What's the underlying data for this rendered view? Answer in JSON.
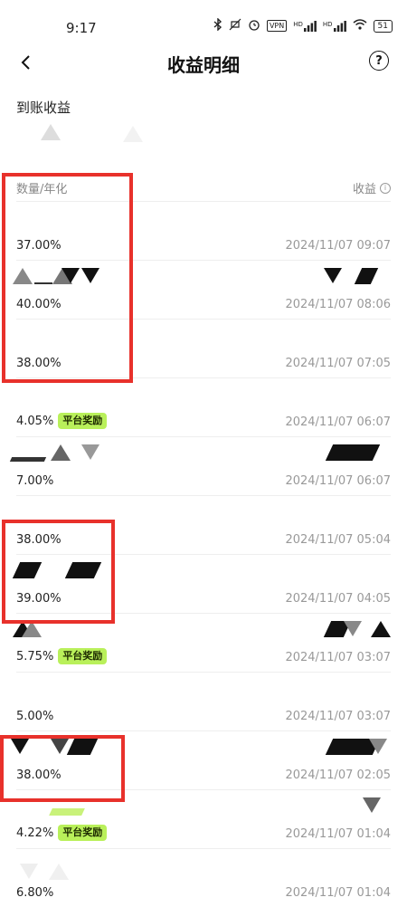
{
  "status_bar": {
    "time": "9:17",
    "icons": [
      "bluetooth-icon",
      "mute-icon",
      "alarm-icon",
      "vpn-icon",
      "signal-icon",
      "signal-icon",
      "wifi-icon",
      "battery-icon"
    ],
    "vpn_label": "VPN",
    "hd1": "HD",
    "hd2": "HD",
    "battery": "51"
  },
  "header": {
    "title": "收益明细"
  },
  "summary": {
    "received_label": "到账收益"
  },
  "table": {
    "col_left": "数量/年化",
    "col_right": "收益",
    "rows": [
      {
        "rate": "37.00%",
        "badge": "",
        "time": "2024/11/07 09:07"
      },
      {
        "rate": "40.00%",
        "badge": "",
        "time": "2024/11/07 08:06"
      },
      {
        "rate": "38.00%",
        "badge": "",
        "time": "2024/11/07 07:05"
      },
      {
        "rate": "4.05%",
        "badge": "平台奖励",
        "time": "2024/11/07 06:07"
      },
      {
        "rate": "7.00%",
        "badge": "",
        "time": "2024/11/07 06:07"
      },
      {
        "rate": "38.00%",
        "badge": "",
        "time": "2024/11/07 05:04"
      },
      {
        "rate": "39.00%",
        "badge": "",
        "time": "2024/11/07 04:05"
      },
      {
        "rate": "5.75%",
        "badge": "平台奖励",
        "time": "2024/11/07 03:07"
      },
      {
        "rate": "5.00%",
        "badge": "",
        "time": "2024/11/07 03:07"
      },
      {
        "rate": "38.00%",
        "badge": "",
        "time": "2024/11/07 02:05"
      },
      {
        "rate": "4.22%",
        "badge": "平台奖励",
        "time": "2024/11/07 01:04"
      },
      {
        "rate": "6.80%",
        "badge": "",
        "time": "2024/11/07 01:04"
      }
    ]
  },
  "colors": {
    "highlight": "#e8312b",
    "badge_bg": "#b9f05a",
    "muted_text": "#999999"
  }
}
